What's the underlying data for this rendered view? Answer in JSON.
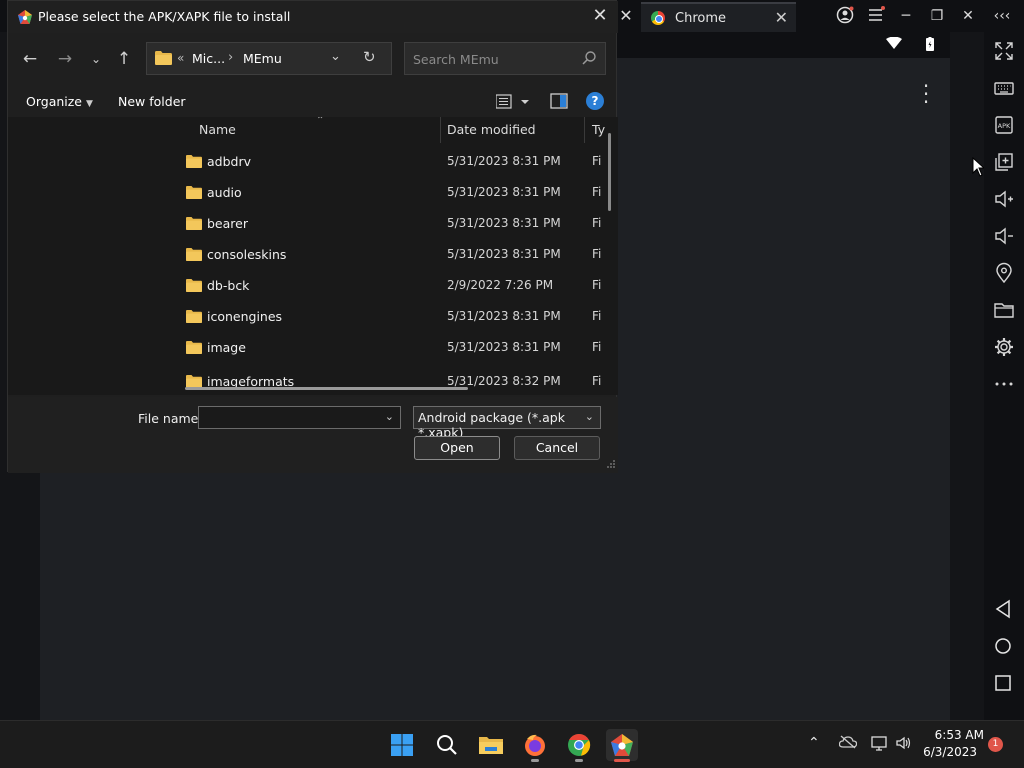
{
  "dialog": {
    "title": "Please select the APK/XAPK file to install",
    "breadcrumb": [
      "«",
      "Mic...",
      "›",
      "MEmu"
    ],
    "search_placeholder": "Search MEmu",
    "organize_label": "Organize",
    "new_folder_label": "New folder",
    "help_label": "?",
    "columns": [
      "Name",
      "Date modified",
      "Ty"
    ],
    "files": [
      {
        "name": "adbdrv",
        "date": "5/31/2023 8:31 PM",
        "type": "Fi"
      },
      {
        "name": "audio",
        "date": "5/31/2023 8:31 PM",
        "type": "Fi"
      },
      {
        "name": "bearer",
        "date": "5/31/2023 8:31 PM",
        "type": "Fi"
      },
      {
        "name": "consoleskins",
        "date": "5/31/2023 8:31 PM",
        "type": "Fi"
      },
      {
        "name": "db-bck",
        "date": "2/9/2022 7:26 PM",
        "type": "Fi"
      },
      {
        "name": "iconengines",
        "date": "5/31/2023 8:31 PM",
        "type": "Fi"
      },
      {
        "name": "image",
        "date": "5/31/2023 8:31 PM",
        "type": "Fi"
      },
      {
        "name": "imageformats",
        "date": "5/31/2023 8:32 PM",
        "type": "Fi"
      }
    ],
    "file_name_label": "File name:",
    "file_name_value": "",
    "file_type_value": "Android package (*.apk *.xapk)",
    "open_label": "Open",
    "cancel_label": "Cancel"
  },
  "emulator": {
    "tab_label": "Chrome"
  },
  "taskbar": {
    "time": "6:53 AM",
    "date": "6/3/2023",
    "notification_count": "1"
  },
  "colors": {
    "folder": "#e8b84a",
    "accent": "#2b7fd6",
    "badge": "#e0564a"
  }
}
